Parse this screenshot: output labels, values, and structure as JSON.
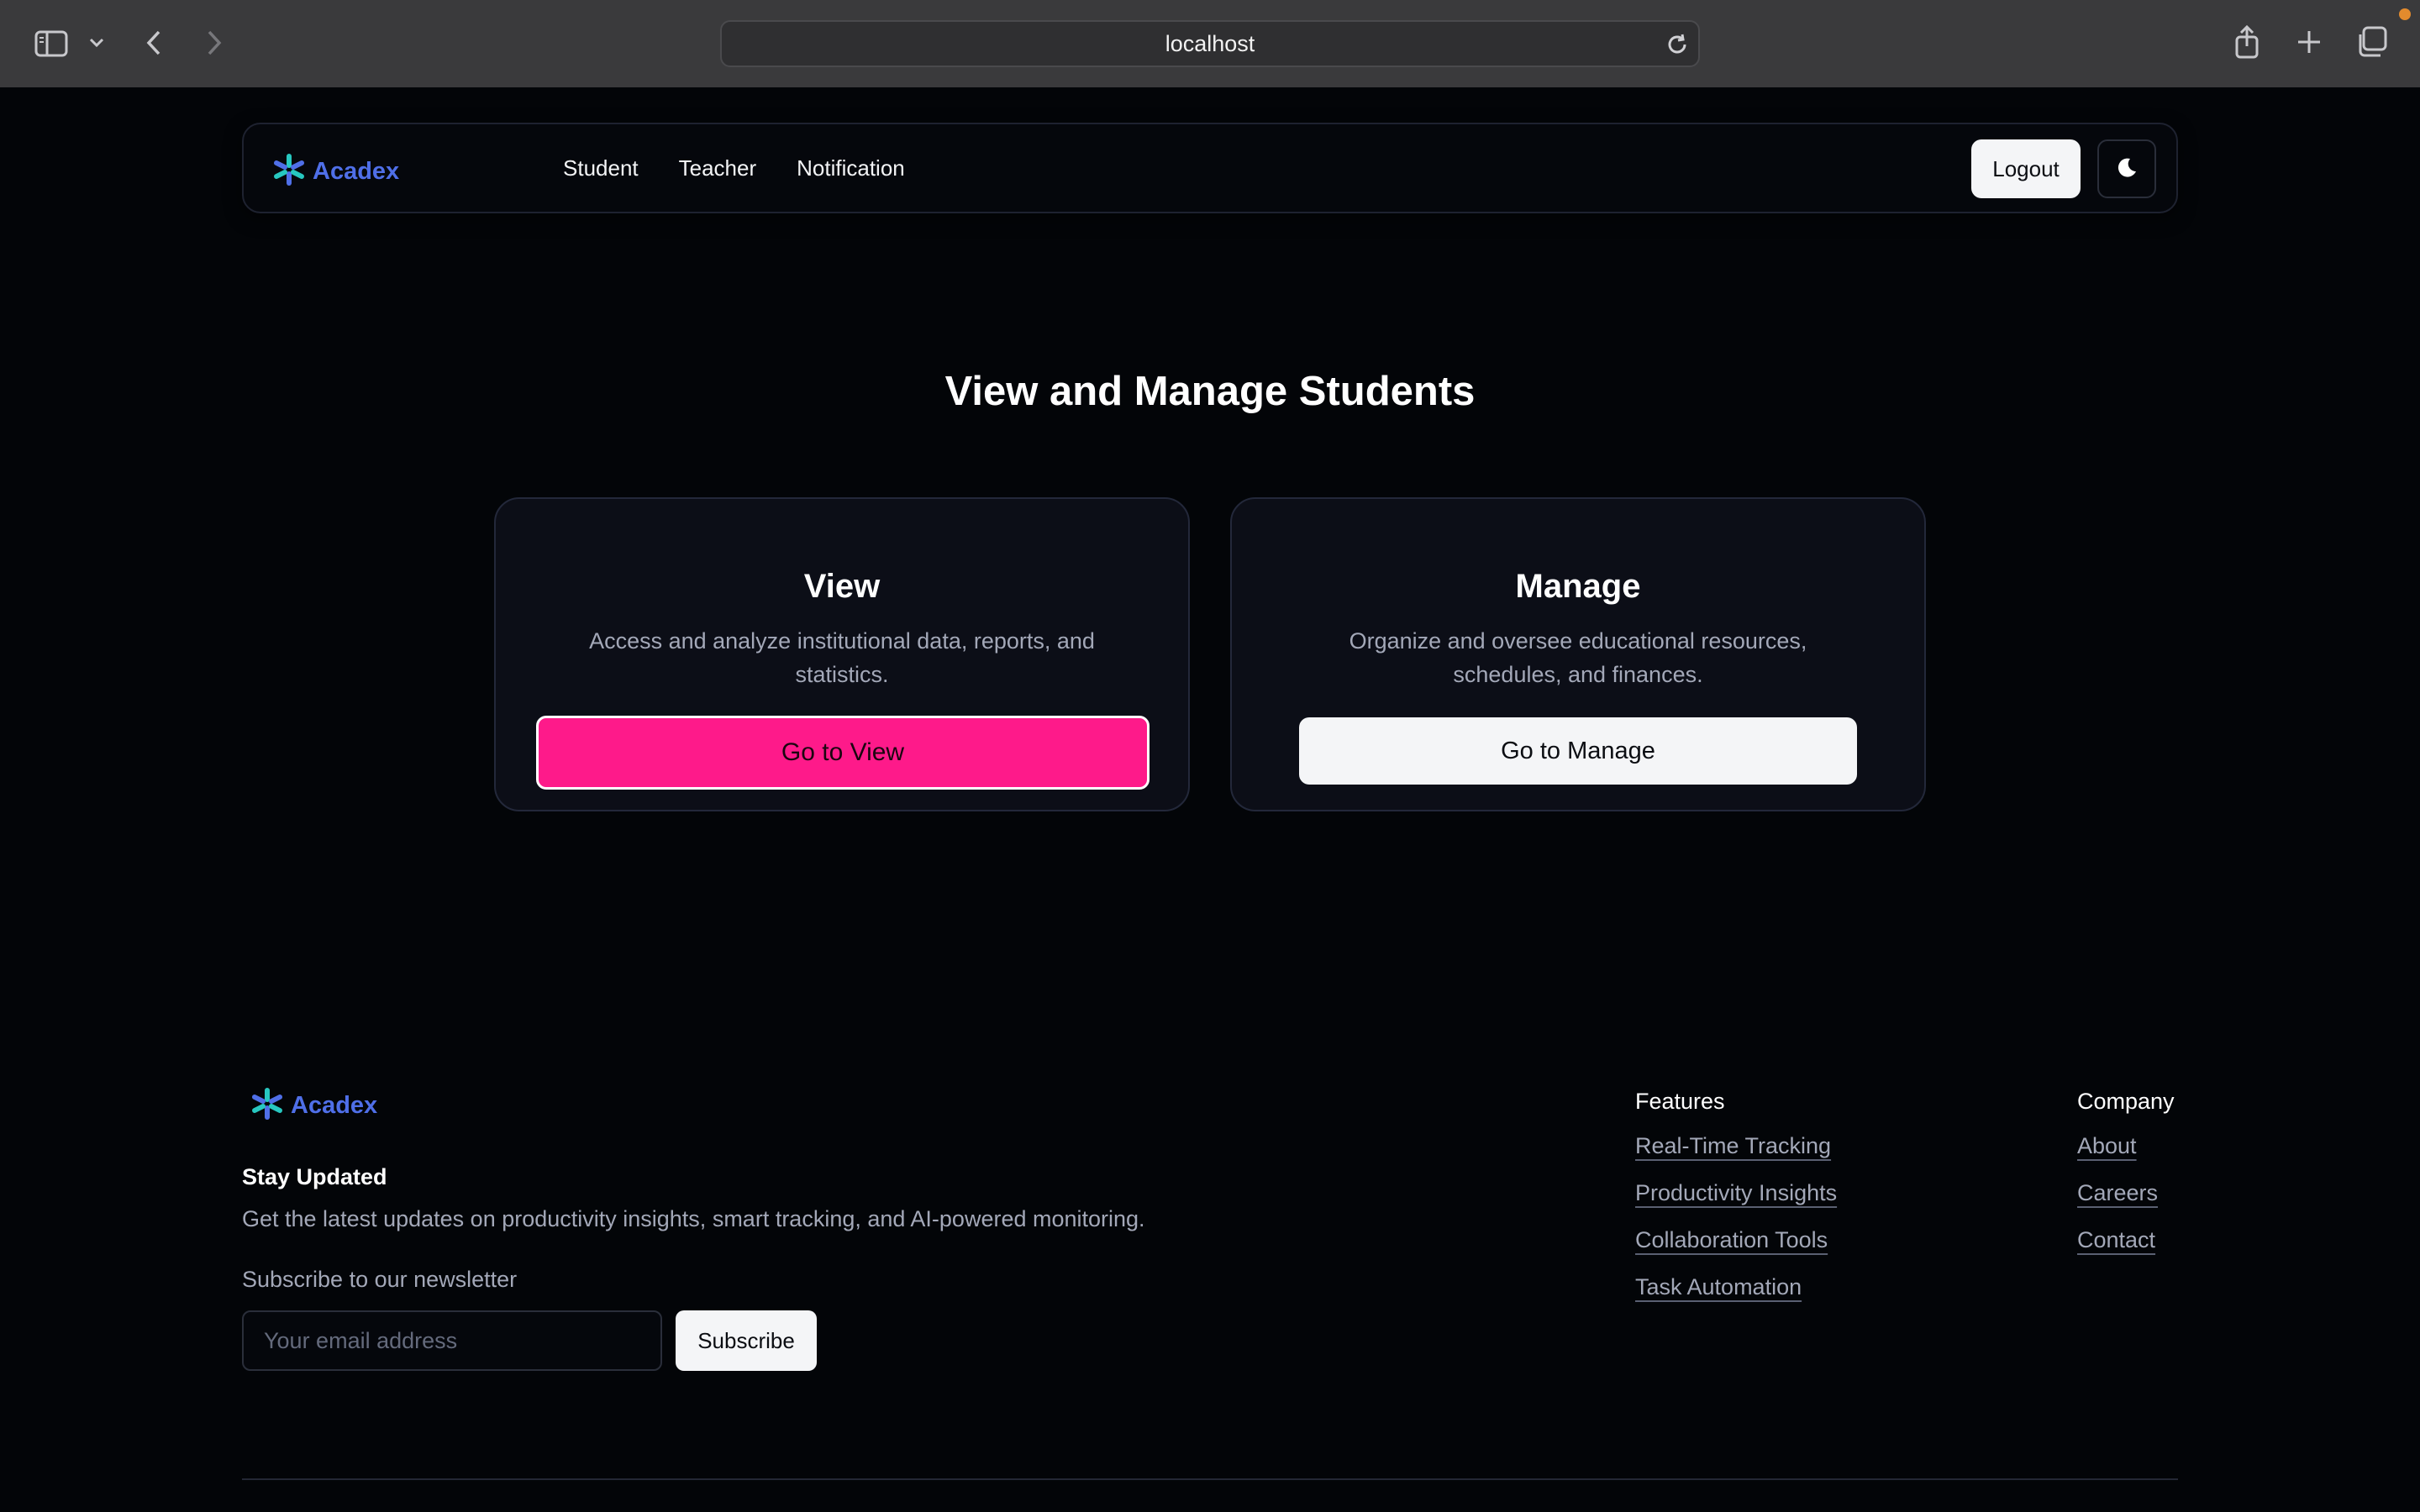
{
  "browser": {
    "url": "localhost"
  },
  "nav": {
    "brand": "Acadex",
    "links": [
      "Student",
      "Teacher",
      "Notification"
    ],
    "logout_label": "Logout"
  },
  "main": {
    "title": "View and Manage Students",
    "cards": [
      {
        "title": "View",
        "description": "Access and analyze institutional data, reports, and statistics.",
        "button_label": "Go to View"
      },
      {
        "title": "Manage",
        "description": "Organize and oversee educational resources, schedules, and finances.",
        "button_label": "Go to Manage"
      }
    ]
  },
  "footer": {
    "brand": "Acadex",
    "stay_title": "Stay Updated",
    "stay_description": "Get the latest updates on productivity insights, smart tracking, and AI-powered monitoring.",
    "newsletter_label": "Subscribe to our newsletter",
    "email_placeholder": "Your email address",
    "subscribe_label": "Subscribe",
    "features": {
      "heading": "Features",
      "links": [
        "Real-Time Tracking",
        "Productivity Insights",
        "Collaboration Tools",
        "Task Automation"
      ]
    },
    "company": {
      "heading": "Company",
      "links": [
        "About",
        "Careers",
        "Contact"
      ]
    }
  },
  "colors": {
    "accent_pink": "#fe1a8a",
    "brand_blue": "#4f6fe8",
    "background": "#030508"
  },
  "icons": [
    "sidebar-icon",
    "chevron-down-icon",
    "back-icon",
    "forward-icon",
    "reload-icon",
    "share-icon",
    "new-tab-icon",
    "tabs-overview-icon",
    "acadex-logo-icon",
    "moon-icon"
  ]
}
